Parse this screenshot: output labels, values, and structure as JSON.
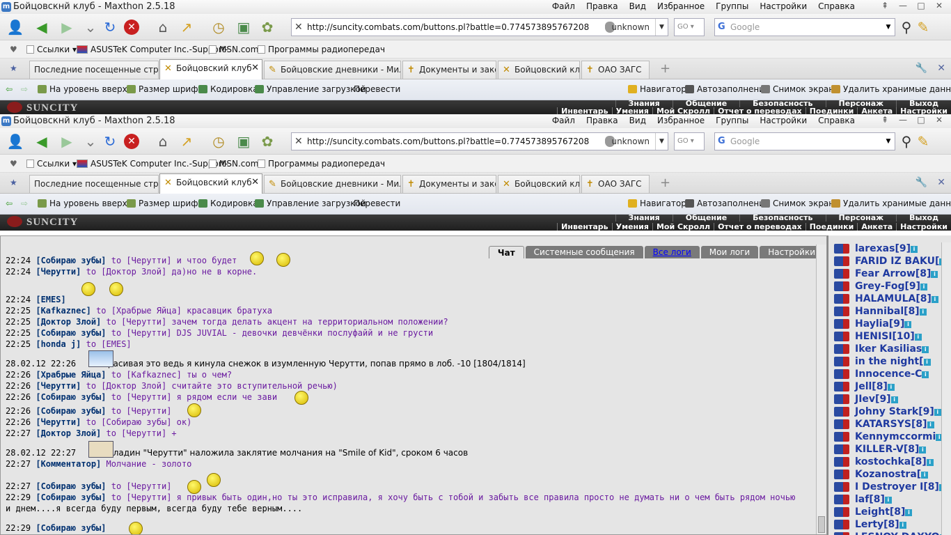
{
  "window": {
    "title": "Бойцовскнй клуб - Maxthon 2.5.18",
    "app_icon": "m",
    "menu": [
      "Файл",
      "Правка",
      "Вид",
      "Избранное",
      "Группы",
      "Настройки",
      "Справка"
    ],
    "controls": [
      "⇞",
      "—",
      "□",
      "✕"
    ]
  },
  "address": {
    "url": "http://suncity.combats.com/buttons.pl?battle=0.774573895767208",
    "security": "unknown",
    "go": "GO",
    "search_placeholder": "Google"
  },
  "favorites": [
    {
      "label": "Ссылки ▾"
    },
    {
      "label": "ASUSTeK Computer Inc.-Support-"
    },
    {
      "label": "MSN.com"
    },
    {
      "label": "Программы радиопередач"
    }
  ],
  "tabs": [
    {
      "label": "Последние посещенные страницы",
      "active": false
    },
    {
      "label": "Бойцовский клуб",
      "active": true
    },
    {
      "label": "Бойцовские дневники - Милый...",
      "active": false
    },
    {
      "label": "Документы и законы",
      "active": false
    },
    {
      "label": "Бойцовский клуб.",
      "active": false
    },
    {
      "label": "ОАО ЗАГС",
      "active": false
    }
  ],
  "toolbar2": {
    "left": [
      "На уровень вверх ▾",
      "Размер шрифта",
      "Кодировка",
      "Управление загрузкой",
      "Перевести"
    ],
    "right": [
      "Навигатор",
      "Автозаполнение",
      "Снимок экрана",
      "Удалить хранимые данные..."
    ]
  },
  "game": {
    "logo": "SUNCITY",
    "row1": [
      "Знания",
      "Общение",
      "Безопасность",
      "Персонаж",
      "Выход"
    ],
    "row2": [
      "Инвентарь",
      "Умения",
      "Мой Скролл",
      "Отчет о переводах",
      "Поединки",
      "Анкета",
      "Настройки"
    ]
  },
  "chat": {
    "tabs": [
      "Чат",
      "Системные сообщения",
      "Все логи",
      "Мои логи",
      "Настройки"
    ],
    "lines": [
      {
        "t": "22:24",
        "nick": "[Собираю зубы]",
        "msg": " to [Черутти] и чтоо будет"
      },
      {
        "t": "22:24",
        "nick": "[Черутти]",
        "msg": " to [Доктор Злой] да)но не в корне."
      },
      {
        "t": "22:24",
        "nick": "[EMES]",
        "msg": ""
      },
      {
        "t": "22:25",
        "nick": "[Kafkaznec]",
        "msg": " to [Храбрые Яйца] красавцик братуха"
      },
      {
        "t": "22:25",
        "nick": "[Доктор Злой]",
        "msg": " to [Черутти] зачем тогда делать акцент на территориальном положении?"
      },
      {
        "t": "22:25",
        "nick": "[Собираю зубы]",
        "msg": " to [Черутти] DJS JUVIAL - девочки девчёнки послуфайй и не грусти"
      },
      {
        "t": "22:25",
        "nick": "[honda j]",
        "msg": " to [EMES]"
      },
      {
        "t": "28.02.12 22:26",
        "nick": "",
        "msg": "Красивая это ведь я кинула снежок в изумленную Черутти, попав прямо в лоб. -10 [1804/1814]"
      },
      {
        "t": "22:26",
        "nick": "[Храбрые Яйца]",
        "msg": " to [Kafkaznec] ты о чем?"
      },
      {
        "t": "22:26",
        "nick": "[Черутти]",
        "msg": " to [Доктор Злой] считайте это вступительной речью)"
      },
      {
        "t": "22:26",
        "nick": "[Собираю зубы]",
        "msg": " to [Черутти] я рядом если че зави"
      },
      {
        "t": "22:26",
        "nick": "[Собираю зубы]",
        "msg": " to [Черутти]"
      },
      {
        "t": "22:26",
        "nick": "[Черутти]",
        "msg": " to [Собираю зубы] ок)"
      },
      {
        "t": "22:27",
        "nick": "[Доктор Злой]",
        "msg": " to [Черутти] +"
      },
      {
        "t": "28.02.12 22:27",
        "nick": "",
        "msg": "Паладин \"Черутти\" наложила заклятие молчания на \"Smile of Kid\", сроком 6 часов"
      },
      {
        "t": "22:27",
        "nick": "[Комментатор]",
        "msg": " Молчание - золото"
      },
      {
        "t": "22:27",
        "nick": "[Собираю зубы]",
        "msg": " to [Черутти]"
      },
      {
        "t": "22:29",
        "nick": "[Собираю зубы]",
        "msg": " to [Черутти] я привык быть один,но ты это исправила, я хочу быть с тобой и забыть все правила просто не думать ни о чем быть рядом ночью"
      },
      {
        "t": "",
        "nick": "",
        "msg": "и днем....я всегда буду первым, всегда буду тебе верным...."
      },
      {
        "t": "22:29",
        "nick": "[Собираю зубы]",
        "msg": ""
      }
    ]
  },
  "users": [
    "larexas[9]",
    "FARID IZ BAKU[",
    "Fear Arrow[8]",
    "Grey-Fog[9]",
    "HALAMULA[8]",
    "Hannibal[8]",
    "Haylia[9]",
    "HENISI[10]",
    "Iker Kasilias",
    "in the night[",
    "Innocence-C",
    "Jell[8]",
    "JIev[9]",
    "Johny Stark[9]",
    "KATARSYS[8]",
    "Kennymccormi",
    "KILLER-V[8]",
    "kostochka[8]",
    "Kozanostra[",
    "I Destroyer I[8]",
    "laf[8]",
    "Leight[8]",
    "Lerty[8]",
    "LESNOY DAXYO"
  ]
}
